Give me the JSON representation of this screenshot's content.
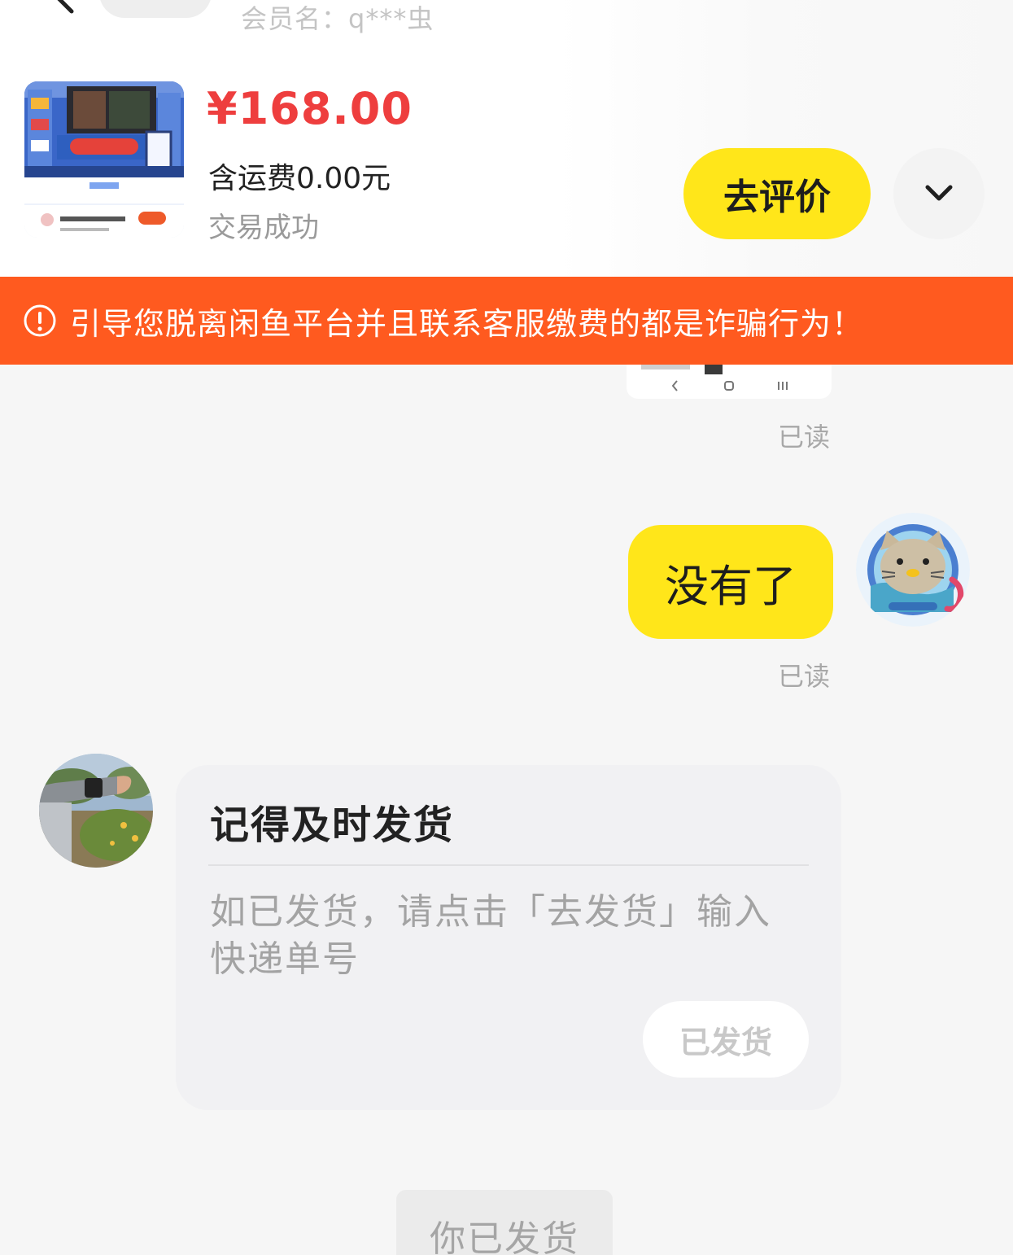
{
  "header": {
    "member_name": "会员名：q***虫"
  },
  "product": {
    "price": "¥168.00",
    "shipping": "含运费0.00元",
    "status": "交易成功",
    "review_button": "去评价"
  },
  "banner": {
    "warning_text": "引导您脱离闲鱼平台并且联系客服缴费的都是诈骗行为！"
  },
  "chat": {
    "read_label_1": "已读",
    "my_message": "没有了",
    "read_label_2": "已读",
    "reminder_card": {
      "title": "记得及时发货",
      "description": "如已发货，请点击「去发货」输入快递单号",
      "button": "已发货"
    },
    "system_message": "你已发货"
  },
  "colors": {
    "accent_yellow": "#ffe61a",
    "price_red": "#ee3e3e",
    "warning_orange": "#ff5a1f"
  },
  "icons": [
    "back-arrow-icon",
    "chevron-down-icon",
    "warning-circle-icon"
  ]
}
